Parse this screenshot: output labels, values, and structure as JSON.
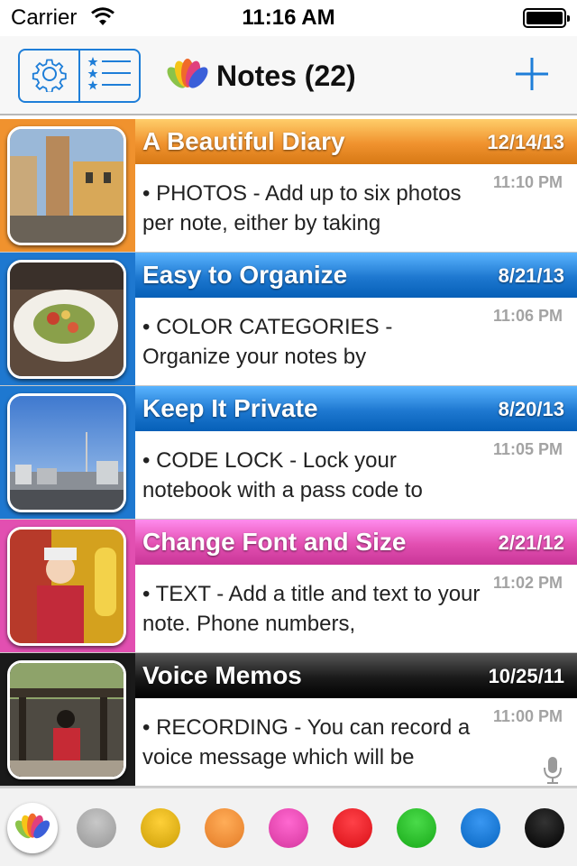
{
  "status": {
    "carrier": "Carrier",
    "time": "11:16 AM"
  },
  "nav": {
    "title": "Notes (22)"
  },
  "notes": [
    {
      "title": "A Beautiful Diary",
      "date": "12/14/13",
      "time": "11:10 PM",
      "preview": "• PHOTOS - Add up to six photos per note, either by taking",
      "color": "#f0922e",
      "thumb": "street-photo"
    },
    {
      "title": "Easy to Organize",
      "date": "8/21/13",
      "time": "11:06 PM",
      "preview": "• COLOR CATEGORIES - Organize your notes by",
      "color": "#1e78d0",
      "thumb": "food-photo"
    },
    {
      "title": "Keep It Private",
      "date": "8/20/13",
      "time": "11:05 PM",
      "preview": "• CODE LOCK - Lock your notebook with a pass code to",
      "color": "#1e78d0",
      "thumb": "skyline-photo"
    },
    {
      "title": "Change Font and Size",
      "date": "2/21/12",
      "time": "11:02 PM",
      "preview": "• TEXT - Add a title and text to your note. Phone numbers,",
      "color": "#e24fb1",
      "thumb": "child-photo"
    },
    {
      "title": "Voice Memos",
      "date": "10/25/11",
      "time": "11:00 PM",
      "preview": "• RECORDING - You can record a voice message which will be",
      "color": "#1a1a1a",
      "thumb": "shrine-photo",
      "has_audio": true
    }
  ],
  "categories": [
    "#aaaaaa",
    "#e0b21a",
    "#ef8f3a",
    "#e64ab2",
    "#e8232a",
    "#2cbd2c",
    "#1b79d4",
    "#151515"
  ]
}
